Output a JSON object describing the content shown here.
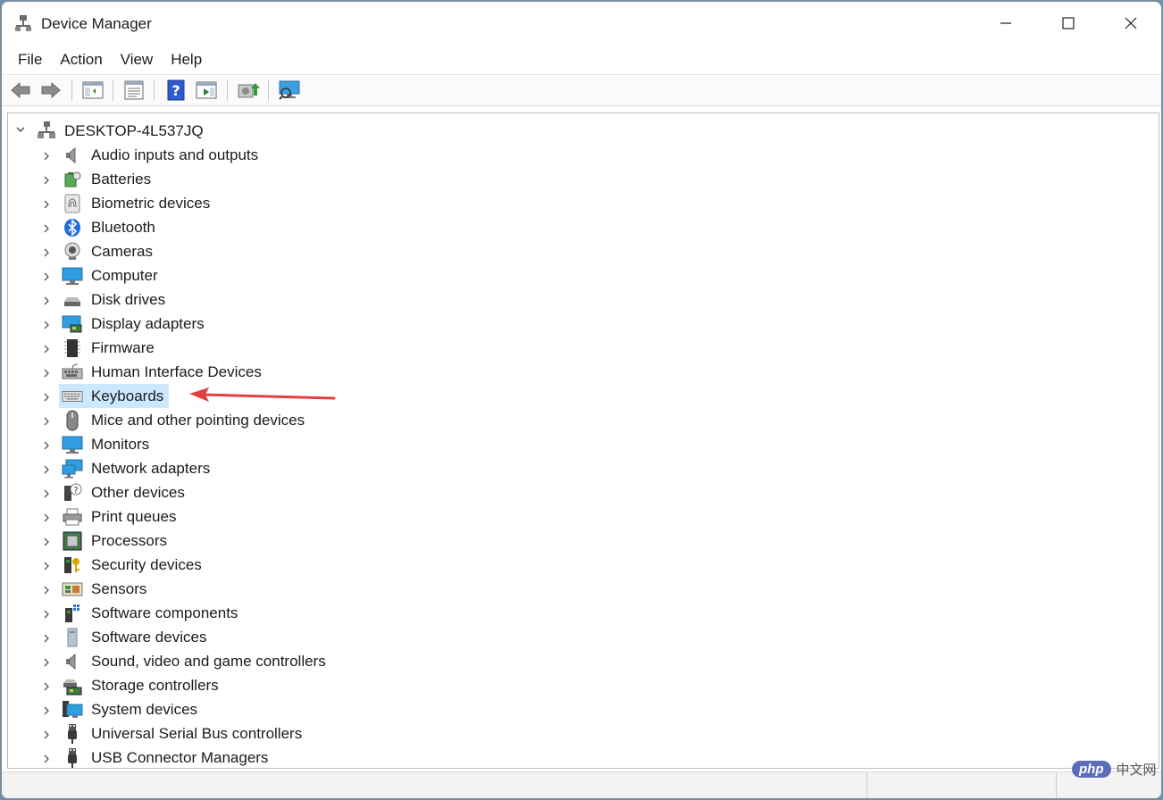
{
  "window": {
    "title": "Device Manager"
  },
  "menu": [
    "File",
    "Action",
    "View",
    "Help"
  ],
  "toolbar": {
    "buttons": [
      "back-icon",
      "forward-icon",
      "show-hide-console-tree-icon",
      "properties-icon",
      "help-icon",
      "run-icon",
      "update-driver-icon",
      "scan-hardware-icon"
    ]
  },
  "tree": {
    "root": "DESKTOP-4L537JQ",
    "categories": [
      "Audio inputs and outputs",
      "Batteries",
      "Biometric devices",
      "Bluetooth",
      "Cameras",
      "Computer",
      "Disk drives",
      "Display adapters",
      "Firmware",
      "Human Interface Devices",
      "Keyboards",
      "Mice and other pointing devices",
      "Monitors",
      "Network adapters",
      "Other devices",
      "Print queues",
      "Processors",
      "Security devices",
      "Sensors",
      "Software components",
      "Software devices",
      "Sound, video and game controllers",
      "Storage controllers",
      "System devices",
      "Universal Serial Bus controllers",
      "USB Connector Managers"
    ],
    "selected": "Keyboards"
  },
  "watermark": {
    "badge": "php",
    "text": "中文网"
  },
  "colors": {
    "selection": "#cce8ff",
    "annotation_arrow": "#e04040"
  }
}
